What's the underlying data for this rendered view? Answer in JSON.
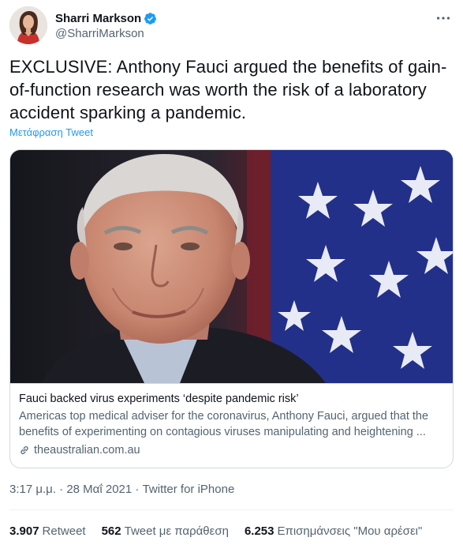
{
  "author": {
    "display_name": "Sharri Markson",
    "handle": "@SharriMarkson",
    "verified_icon": "verified-badge-icon",
    "avatar_icon": "profile-photo"
  },
  "tweet": {
    "text": "EXCLUSIVE: Anthony Fauci argued the benefits of gain-\nof-function research was worth the risk of a laboratory\naccident sparking a pandemic.",
    "translate_label": "Μετάφραση Tweet"
  },
  "card": {
    "title": "Fauci backed virus experiments ‘despite pandemic risk’",
    "description_line1": "Americas top medical adviser for the coronavirus, Anthony Fauci, argued that the",
    "description_line2": "benefits of experimenting on contagious viruses manipulating and heightening ...",
    "domain": "theaustralian.com.au",
    "image_icon": "article-photo"
  },
  "meta": {
    "time": "3:17 μ.μ.",
    "separator": " · ",
    "date": "28 Μαΐ 2021",
    "source": "Twitter for iPhone"
  },
  "stats": {
    "retweets_count": "3.907",
    "retweets_label": "Retweet",
    "quotes_count": "562",
    "quotes_label": "Tweet με παράθεση",
    "likes_count": "6.253",
    "likes_label": "Επισημάνσεις \"Μου αρέσει\""
  },
  "colors": {
    "accent": "#1d9bf0",
    "text": "#0f1419",
    "secondary": "#536471",
    "border": "#cfd9de"
  }
}
